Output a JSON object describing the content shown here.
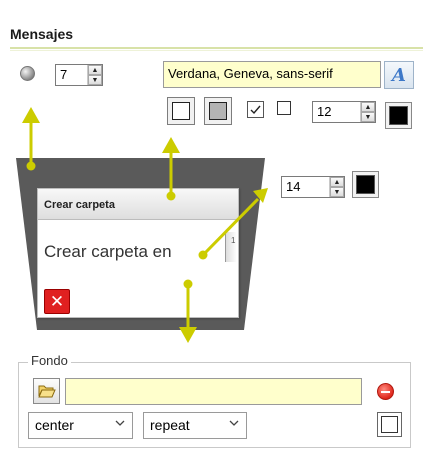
{
  "section": {
    "title": "Mensajes"
  },
  "controls": {
    "radius_value": "7",
    "font_family": "Verdana, Geneva, sans-serif",
    "font_button_glyph": "A",
    "font_size": "12",
    "font_color": "#000000",
    "border_checked_mark": "☑",
    "title_font_size": "14",
    "title_font_color": "#000000",
    "icons": [
      "corner-radius-icon",
      "spin-up-icon",
      "spin-down-icon",
      "font-picker-icon",
      "border-none-icon",
      "border-gray-icon",
      "checkbox-checked-icon",
      "checkbox-empty-icon"
    ]
  },
  "preview": {
    "title": "Crear carpeta",
    "body_text": "Crear carpeta en",
    "close_glyph": "✕",
    "edge_text": "1"
  },
  "fondo": {
    "legend": "Fondo",
    "image_value": "",
    "position_select": "center",
    "repeat_select": "repeat",
    "icons": [
      "folder-open-icon",
      "remove-icon",
      "chevron-down-icon"
    ]
  },
  "colors": {
    "accent_yellow": "#cccc00",
    "input_bg": "#ffffcc",
    "shadow_gray": "#555555",
    "close_red": "#e02020",
    "rule": "#d8e2a8"
  }
}
